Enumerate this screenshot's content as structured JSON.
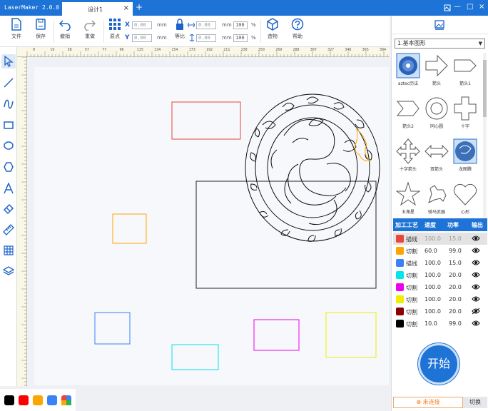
{
  "titlebar": {
    "app_title": "LaserMaker 2.0.0 Alpha",
    "tab_label": "设计1",
    "tab_close": "×",
    "tab_add": "+",
    "min": "—",
    "max": "□",
    "close": "×"
  },
  "toolbar": {
    "file": "文件",
    "save": "保存",
    "undo": "撤销",
    "redo": "重做",
    "origin": "原点",
    "x_label": "X",
    "y_label": "Y",
    "x_value": "0.00",
    "y_value": "0.00",
    "unit_mm": "mm",
    "w_value": "0.00",
    "h_value": "0.00",
    "w_pct": "100",
    "h_pct": "100",
    "pct": "%",
    "ratio": "等比",
    "build": "造物",
    "help": "帮助"
  },
  "ruler": {
    "marks": [
      "0",
      "19",
      "38",
      "57",
      "77",
      "96",
      "115",
      "134",
      "154",
      "173",
      "192",
      "211",
      "230",
      "250",
      "269",
      "288",
      "307",
      "327",
      "346",
      "365",
      "384"
    ]
  },
  "colors": {
    "accent": "#1e73d6",
    "palette": [
      "#000000",
      "#ff0000",
      "#ffa500",
      "#3b82f6"
    ]
  },
  "library": {
    "category": "1.基本图形",
    "items": [
      "aztec历法",
      "箭头",
      "箭头1",
      "箭头2",
      "同心圆",
      "十字",
      "十字箭头",
      "双箭头",
      "龙图腾",
      "五角星",
      "骑马武器",
      "心形"
    ]
  },
  "layers": {
    "headers": [
      "加工工艺",
      "速度",
      "功率",
      "输出"
    ],
    "rows": [
      {
        "color": "#e8453c",
        "mode": "描线",
        "speed": "100.0",
        "power": "15.0",
        "icon": "eye-icon"
      },
      {
        "color": "#ffa500",
        "mode": "切割",
        "speed": "60.0",
        "power": "99.0",
        "icon": "eye-icon"
      },
      {
        "color": "#3b82f6",
        "mode": "描线",
        "speed": "100.0",
        "power": "15.0",
        "icon": "eye-icon"
      },
      {
        "color": "#00e5ee",
        "mode": "切割",
        "speed": "100.0",
        "power": "20.0",
        "icon": "eye-icon"
      },
      {
        "color": "#ee00ee",
        "mode": "切割",
        "speed": "100.0",
        "power": "20.0",
        "icon": "eye-icon"
      },
      {
        "color": "#eeee00",
        "mode": "切割",
        "speed": "100.0",
        "power": "20.0",
        "icon": "eye-icon"
      },
      {
        "color": "#8b0000",
        "mode": "切割",
        "speed": "100.0",
        "power": "20.0",
        "icon": "eye-off-icon"
      },
      {
        "color": "#000000",
        "mode": "切割",
        "speed": "10.0",
        "power": "99.0",
        "icon": "eye-icon"
      }
    ]
  },
  "actions": {
    "start": "开始",
    "status": "未连接",
    "switch": "切换"
  }
}
